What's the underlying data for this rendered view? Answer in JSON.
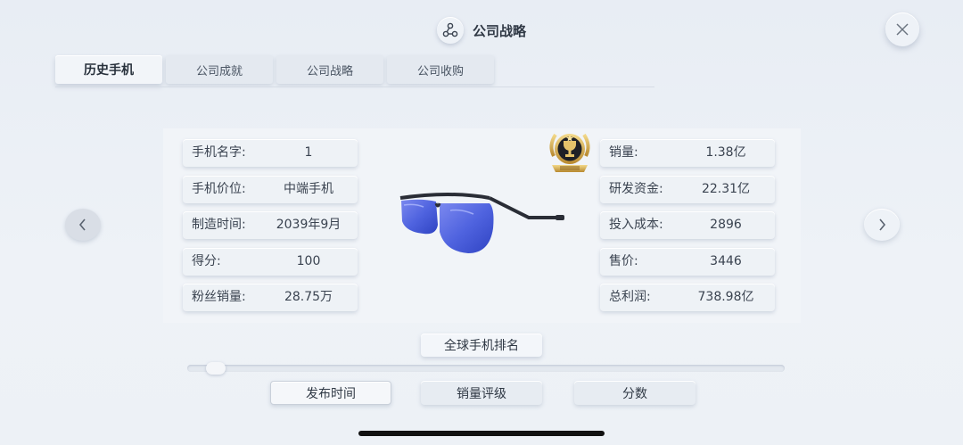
{
  "header": {
    "title": "公司战略",
    "icon": "strategy-nodes-icon"
  },
  "close": {
    "icon": "close-icon"
  },
  "tabs": [
    {
      "label": "历史手机",
      "active": true
    },
    {
      "label": "公司成就",
      "active": false
    },
    {
      "label": "公司战略",
      "active": false
    },
    {
      "label": "公司收购",
      "active": false
    }
  ],
  "left_fields": [
    {
      "label": "手机名字:",
      "value": "1"
    },
    {
      "label": "手机价位:",
      "value": "中端手机"
    },
    {
      "label": "制造时间:",
      "value": "2039年9月"
    },
    {
      "label": "得分:",
      "value": "100"
    },
    {
      "label": "粉丝销量:",
      "value": "28.75万"
    }
  ],
  "right_fields": [
    {
      "label": "销量:",
      "value": "1.38亿"
    },
    {
      "label": "研发资金:",
      "value": "22.31亿"
    },
    {
      "label": "投入成本:",
      "value": "2896"
    },
    {
      "label": "售价:",
      "value": "3446"
    },
    {
      "label": "总利润:",
      "value": "738.98亿"
    }
  ],
  "product_image": "blue-lens-glasses",
  "badge_icon": "trophy-award-badge",
  "nav": {
    "prev_icon": "chevron-left-icon",
    "next_icon": "chevron-right-icon"
  },
  "rank_button": {
    "label": "全球手机排名"
  },
  "slider": {
    "position": 0.03
  },
  "sort_buttons": [
    {
      "label": "发布时间",
      "selected": true
    },
    {
      "label": "销量评级",
      "selected": false
    },
    {
      "label": "分数",
      "selected": false
    }
  ],
  "colors": {
    "lens_blue": "#5b6fe0",
    "frame_dark": "#2a2d36",
    "badge_gold": "#c9a04a"
  }
}
